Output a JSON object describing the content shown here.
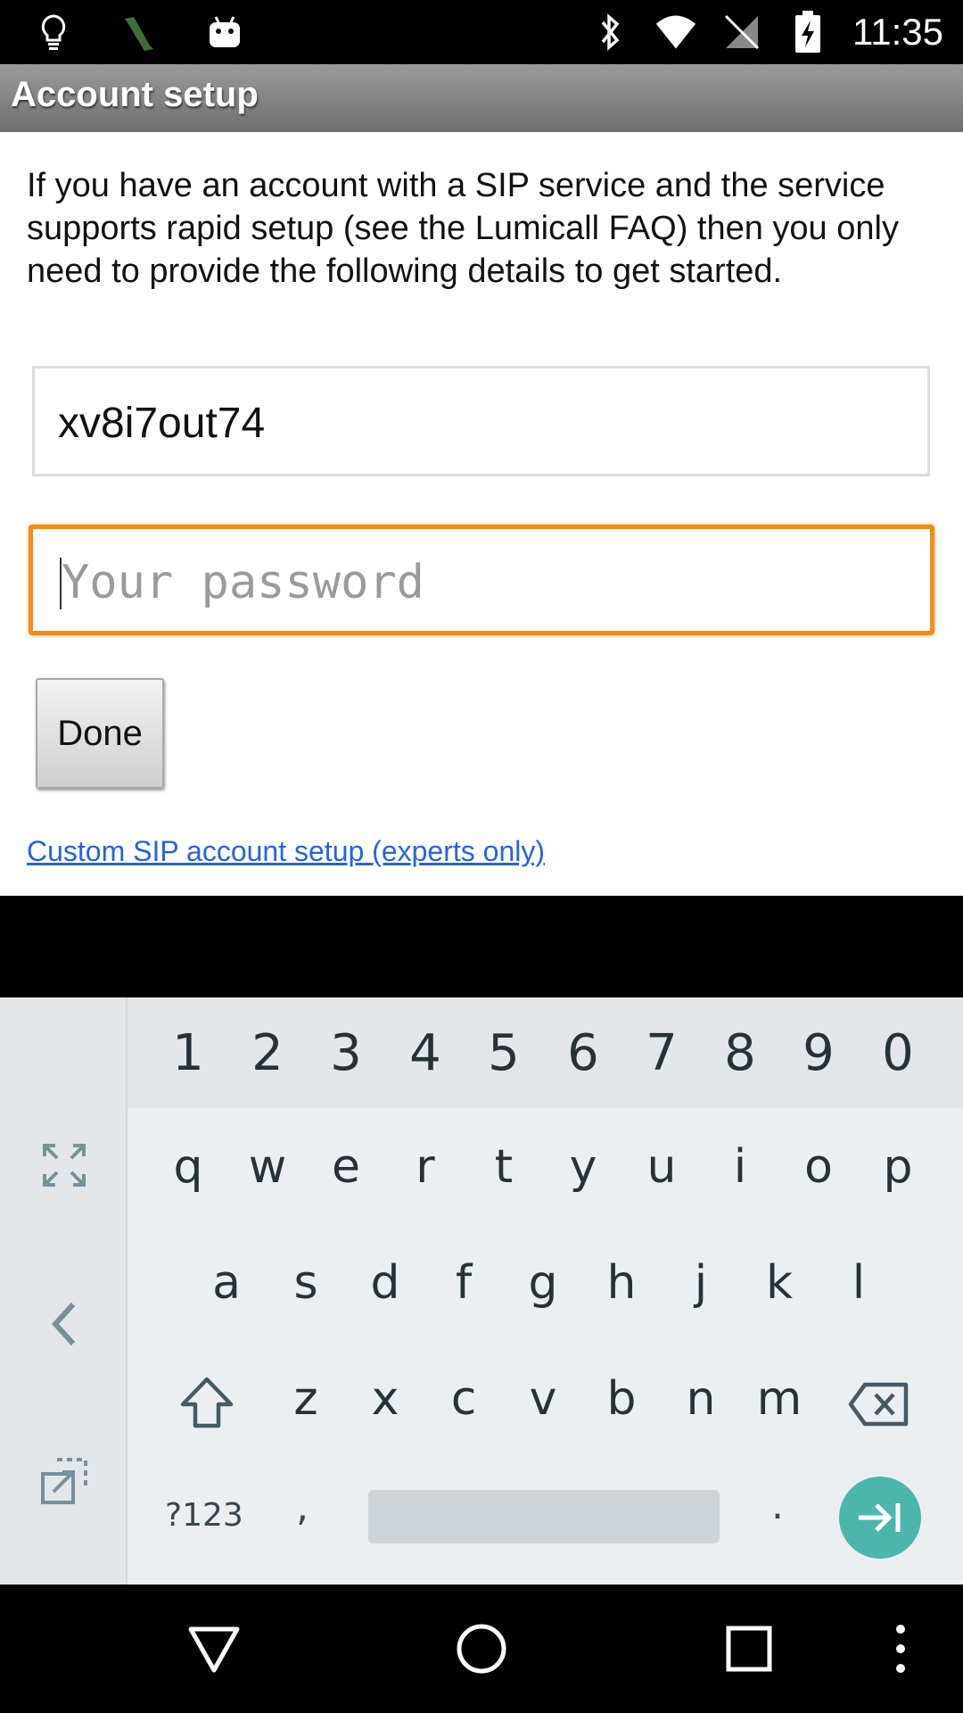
{
  "status_bar": {
    "time": "11:35",
    "icons": [
      "lightbulb-icon",
      "app-icon",
      "android-icon",
      "bluetooth-icon",
      "wifi-icon",
      "no-sim-icon",
      "battery-charging-icon"
    ]
  },
  "title_bar": {
    "title": "Account setup"
  },
  "content": {
    "intro": "If you have an account with a SIP service and the service supports rapid setup (see the Lumicall FAQ) then you only need to provide the following details to get started.",
    "username_value": "xv8i7out74",
    "password_placeholder": "Your password",
    "done_label": "Done",
    "custom_link": "Custom SIP account setup (experts only)"
  },
  "keyboard": {
    "number_row": [
      "1",
      "2",
      "3",
      "4",
      "5",
      "6",
      "7",
      "8",
      "9",
      "0"
    ],
    "row1": [
      "q",
      "w",
      "e",
      "r",
      "t",
      "y",
      "u",
      "i",
      "o",
      "p"
    ],
    "row2": [
      "a",
      "s",
      "d",
      "f",
      "g",
      "h",
      "j",
      "k",
      "l"
    ],
    "row3": [
      "z",
      "x",
      "c",
      "v",
      "b",
      "n",
      "m"
    ],
    "symbols_label": "?123",
    "comma": ",",
    "period": ".",
    "accent_color": "#4db6ac"
  },
  "colors": {
    "focus_border": "#f08c1a",
    "link": "#2a63d8"
  }
}
